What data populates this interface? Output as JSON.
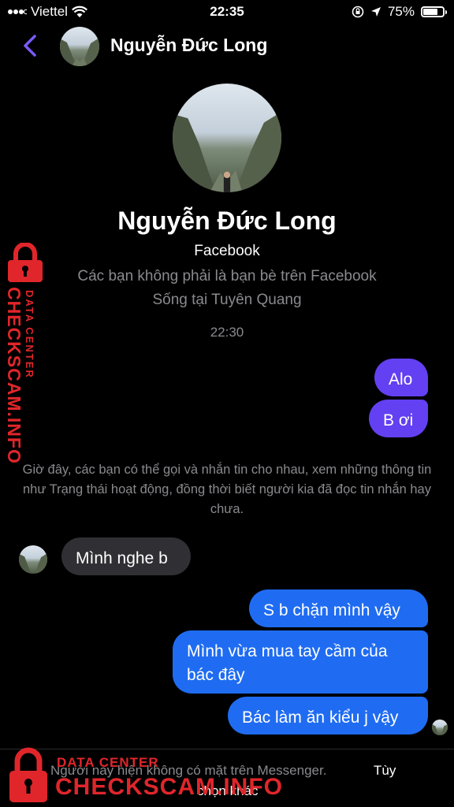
{
  "status_bar": {
    "carrier": "Viettel",
    "time": "22:35",
    "battery_percent": "75%",
    "battery_level": 0.75,
    "icons": [
      "signal-icon",
      "wifi-icon",
      "orientation-lock-icon",
      "location-icon",
      "battery-icon"
    ]
  },
  "header": {
    "back_icon": "chevron-left-icon",
    "name": "Nguyễn Đức Long",
    "accent_color": "#7a5af8"
  },
  "profile": {
    "name": "Nguyễn Đức Long",
    "platform": "Facebook",
    "friend_status": "Các bạn không phải là bạn bè trên Facebook",
    "location": "Sống tại Tuyên Quang"
  },
  "timestamp": "22:30",
  "messages": [
    {
      "from": "me",
      "text": "Alo",
      "color": "#6340f2"
    },
    {
      "from": "me",
      "text": "B ơi",
      "color": "#6340f2"
    },
    {
      "from": "them",
      "text": "Mình nghe b",
      "color": "#303034"
    },
    {
      "from": "me",
      "text": "S b chặn mình vậy",
      "color": "#1f6cf2"
    },
    {
      "from": "me",
      "text": "Mình vừa mua tay cầm của bác đây",
      "color": "#1f6cf2"
    },
    {
      "from": "me",
      "text": "Bác làm ăn kiểu j vậy",
      "color": "#1f6cf2"
    }
  ],
  "info_text": "Giờ đây, các bạn có thể gọi và nhắn tin cho nhau, xem những thông tin như Trạng thái hoạt động, đồng thời biết người kia đã đọc tin nhắn hay chưa.",
  "footer": {
    "text": "Người này hiện không có mặt trên Messenger.",
    "option": "Tùy",
    "option_line2": "chọn khác"
  },
  "watermark": {
    "line1": "DATA CENTER",
    "line2": "CHECKSCAM.INFO",
    "color": "#e0262b"
  }
}
